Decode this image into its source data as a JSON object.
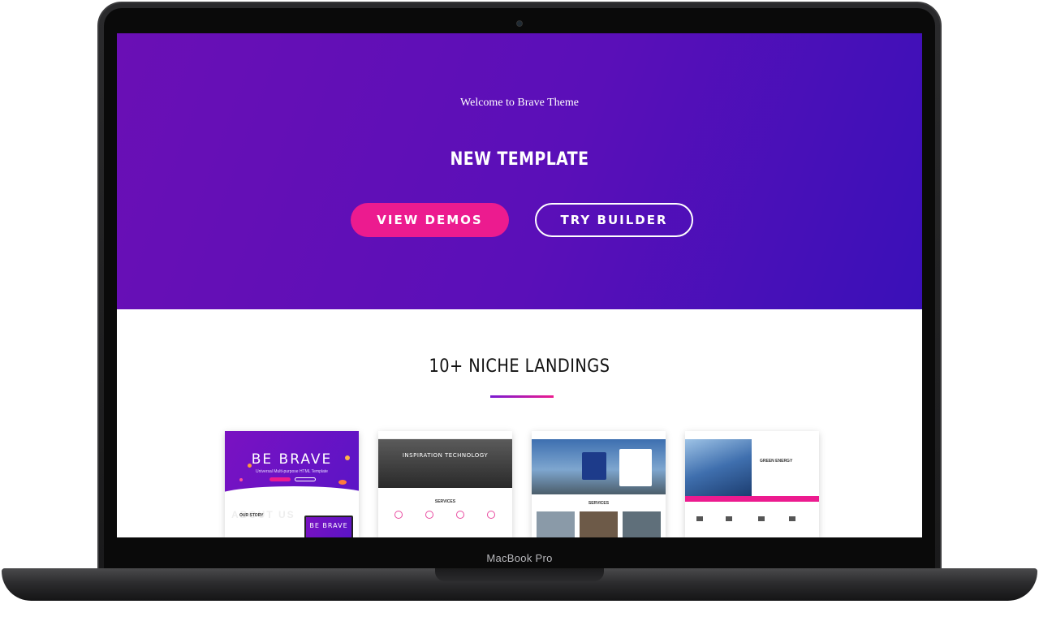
{
  "device": {
    "label": "MacBook Pro"
  },
  "hero": {
    "welcome": "Welcome to Brave Theme",
    "title": "NEW TEMPLATE",
    "buttons": {
      "demos": "VIEW DEMOS",
      "builder": "TRY BUILDER"
    }
  },
  "niche": {
    "title": "10+ NICHE LANDINGS",
    "thumbnails": [
      {
        "brand": "BE BRAVE",
        "sub": "Universal Multi-purpose HTML Template",
        "about": "ABOUT US",
        "story": "OUR STORY",
        "mini_brand": "BE BRAVE"
      },
      {
        "banner": "INSPIRATION TECHNOLOGY",
        "section": "SERVICES"
      },
      {
        "section": "SERVICES"
      },
      {
        "heading": "GREEN ENERGY"
      }
    ]
  },
  "colors": {
    "accent": "#ec1b8f",
    "hero_start": "#6a0fb5",
    "hero_end": "#3a10b8"
  }
}
